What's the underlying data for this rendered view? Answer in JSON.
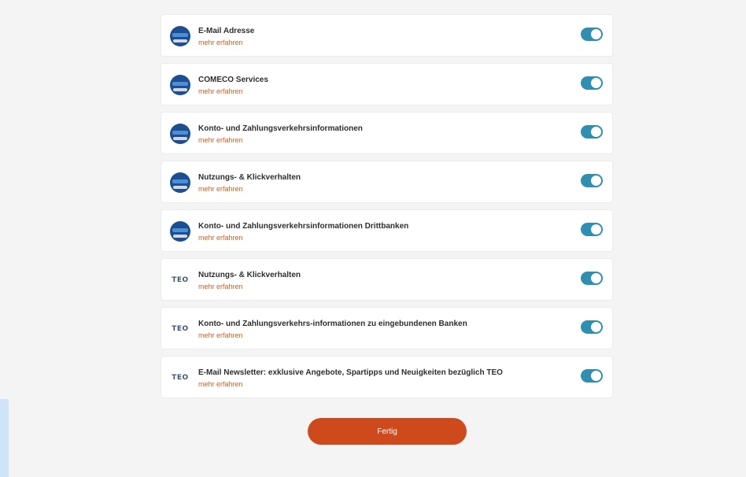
{
  "consents": [
    {
      "logo": "bank-logo",
      "title": "E-Mail Adresse",
      "link": "mehr erfahren",
      "enabled": true
    },
    {
      "logo": "bank-logo",
      "title": "COMECO Services",
      "link": "mehr erfahren",
      "enabled": true
    },
    {
      "logo": "bank-logo",
      "title": "Konto- und Zahlungsverkehrsinformationen",
      "link": "mehr erfahren",
      "enabled": true
    },
    {
      "logo": "bank-logo",
      "title": "Nutzungs- & Klickverhalten",
      "link": "mehr erfahren",
      "enabled": true
    },
    {
      "logo": "bank-logo",
      "title": "Konto- und Zahlungsverkehrsinformationen Drittbanken",
      "link": "mehr erfahren",
      "enabled": true
    },
    {
      "logo": "teo-logo",
      "logo_text": "TEO",
      "title": "Nutzungs- & Klickverhalten",
      "link": "mehr erfahren",
      "enabled": true
    },
    {
      "logo": "teo-logo",
      "logo_text": "TEO",
      "title": "Konto- und Zahlungsverkehrs-informationen zu eingebundenen Banken",
      "link": "mehr erfahren",
      "enabled": true
    },
    {
      "logo": "teo-logo",
      "logo_text": "TEO",
      "title": "E-Mail Newsletter: exklusive Angebote, Spartipps und Neuigkeiten bezüglich TEO",
      "link": "mehr erfahren",
      "enabled": true
    }
  ],
  "done_button": {
    "label": "Fertig"
  },
  "colors": {
    "accent": "#ce4a1d",
    "link": "#d65e25",
    "toggle_on": "#2f8fb0",
    "background": "#f4f4f4"
  }
}
